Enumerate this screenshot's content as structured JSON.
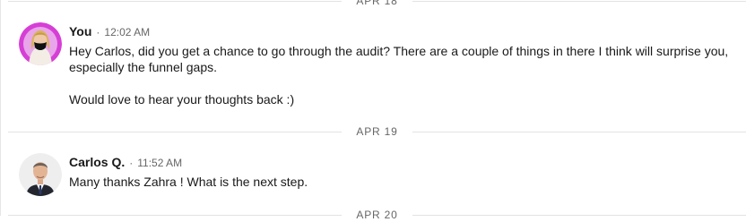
{
  "dividers": {
    "top": "APR 18",
    "middle": "APR 19",
    "bottom": "APR 20"
  },
  "messages": [
    {
      "sender": "You",
      "separator": "·",
      "time": "12:02 AM",
      "text": "Hey Carlos, did you get a chance to go through the audit? There are a couple of things in there I think will surprise you, especially the funnel gaps.\n\nWould love to hear your thoughts back :)"
    },
    {
      "sender": "Carlos Q.",
      "separator": "·",
      "time": "11:52 AM",
      "text": "Many thanks Zahra ! What is the next step."
    }
  ]
}
